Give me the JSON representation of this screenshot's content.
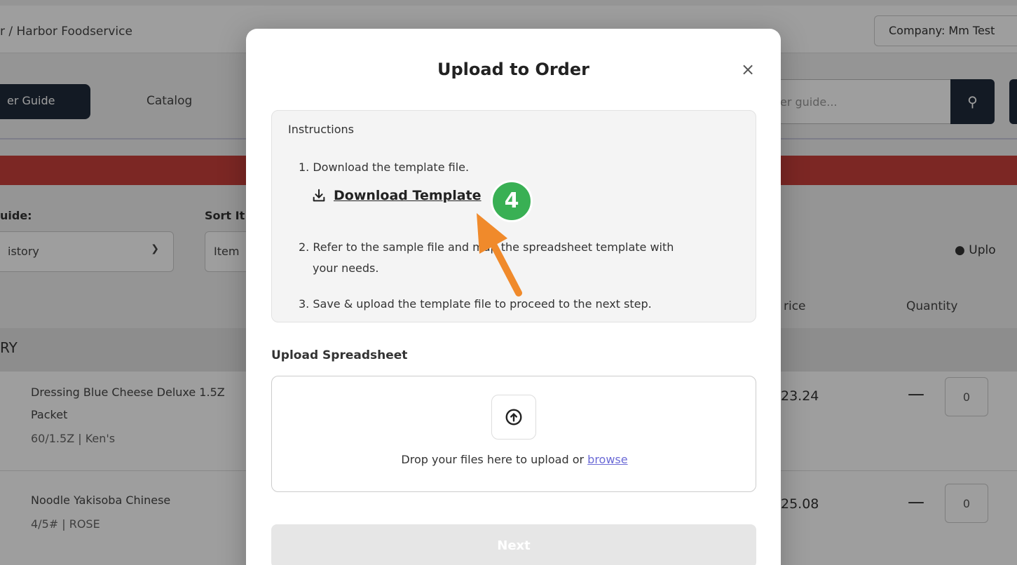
{
  "background": {
    "breadcrumb": "r / Harbor Foodservice",
    "company_label": "Company:  Mm Test",
    "nav_active": "er Guide",
    "nav_catalog": "Catalog",
    "search_placeholder": "er guide...",
    "guide_label": "uide:",
    "sort_label": "Sort It",
    "guide_select": "istory",
    "sort_select": "Item",
    "upload_button": "Uplo",
    "col_price": "rice",
    "col_quantity": "Quantity",
    "category": "RY",
    "products": [
      {
        "name": "Dressing Blue Cheese Deluxe 1.5Z Packet",
        "meta": "60/1.5Z | Ken's",
        "price": "23.24",
        "qty": "0"
      },
      {
        "name": "Noodle Yakisoba Chinese",
        "meta": "4/5# | ROSE",
        "price": "25.08",
        "qty": "0"
      }
    ]
  },
  "modal": {
    "title": "Upload to Order",
    "close": "×",
    "instructions_title": "Instructions",
    "step1": "1. Download the template file.",
    "download_link": "Download Template",
    "step2_line1": "2. Refer to the sample file and map the spreadsheet template with",
    "step2_line2": "your needs.",
    "step3": "3. Save & upload the template file to proceed to the next step.",
    "upload_title": "Upload Spreadsheet",
    "drop_text": "Drop your files here to upload or ",
    "browse": "browse",
    "next": "Next"
  },
  "annotation": {
    "badge_number": "4",
    "badge_color": "#39b054",
    "arrow_color": "#f08a2b"
  }
}
